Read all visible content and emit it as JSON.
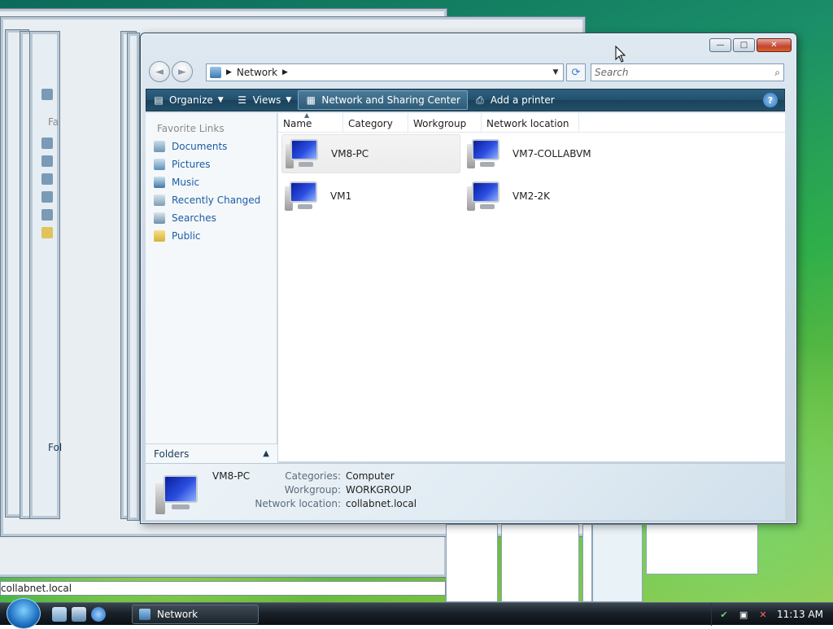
{
  "window": {
    "address_crumb": "Network",
    "search_placeholder": "Search",
    "caption": {
      "minimize": "—",
      "maximize": "□",
      "close": "✕"
    }
  },
  "toolbar": {
    "organize": "Organize",
    "views": "Views",
    "network_sharing": "Network and Sharing Center",
    "add_printer": "Add a printer"
  },
  "nav_pane": {
    "title": "Favorite Links",
    "links": [
      "Documents",
      "Pictures",
      "Music",
      "Recently Changed",
      "Searches",
      "Public"
    ],
    "folders_label": "Folders"
  },
  "columns": [
    "Name",
    "Category",
    "Workgroup",
    "Network location"
  ],
  "items": [
    {
      "label": "VM8-PC",
      "selected": true
    },
    {
      "label": "VM7-COLLABVM",
      "selected": false
    },
    {
      "label": "VM1",
      "selected": false
    },
    {
      "label": "VM2-2K",
      "selected": false
    }
  ],
  "details": {
    "name": "VM8-PC",
    "rows": [
      {
        "key": "Categories:",
        "value": "Computer"
      },
      {
        "key": "Workgroup:",
        "value": "WORKGROUP"
      },
      {
        "key": "Network location:",
        "value": "collabnet.local"
      }
    ]
  },
  "background": {
    "ghost_text_1": "Fa",
    "ghost_text_2": "Fol",
    "status_strip": "collabnet.local"
  },
  "taskbar": {
    "task_label": "Network",
    "clock": "11:13 AM"
  },
  "icons": {
    "computer": "computer-icon",
    "start": "windows-orb-icon"
  }
}
